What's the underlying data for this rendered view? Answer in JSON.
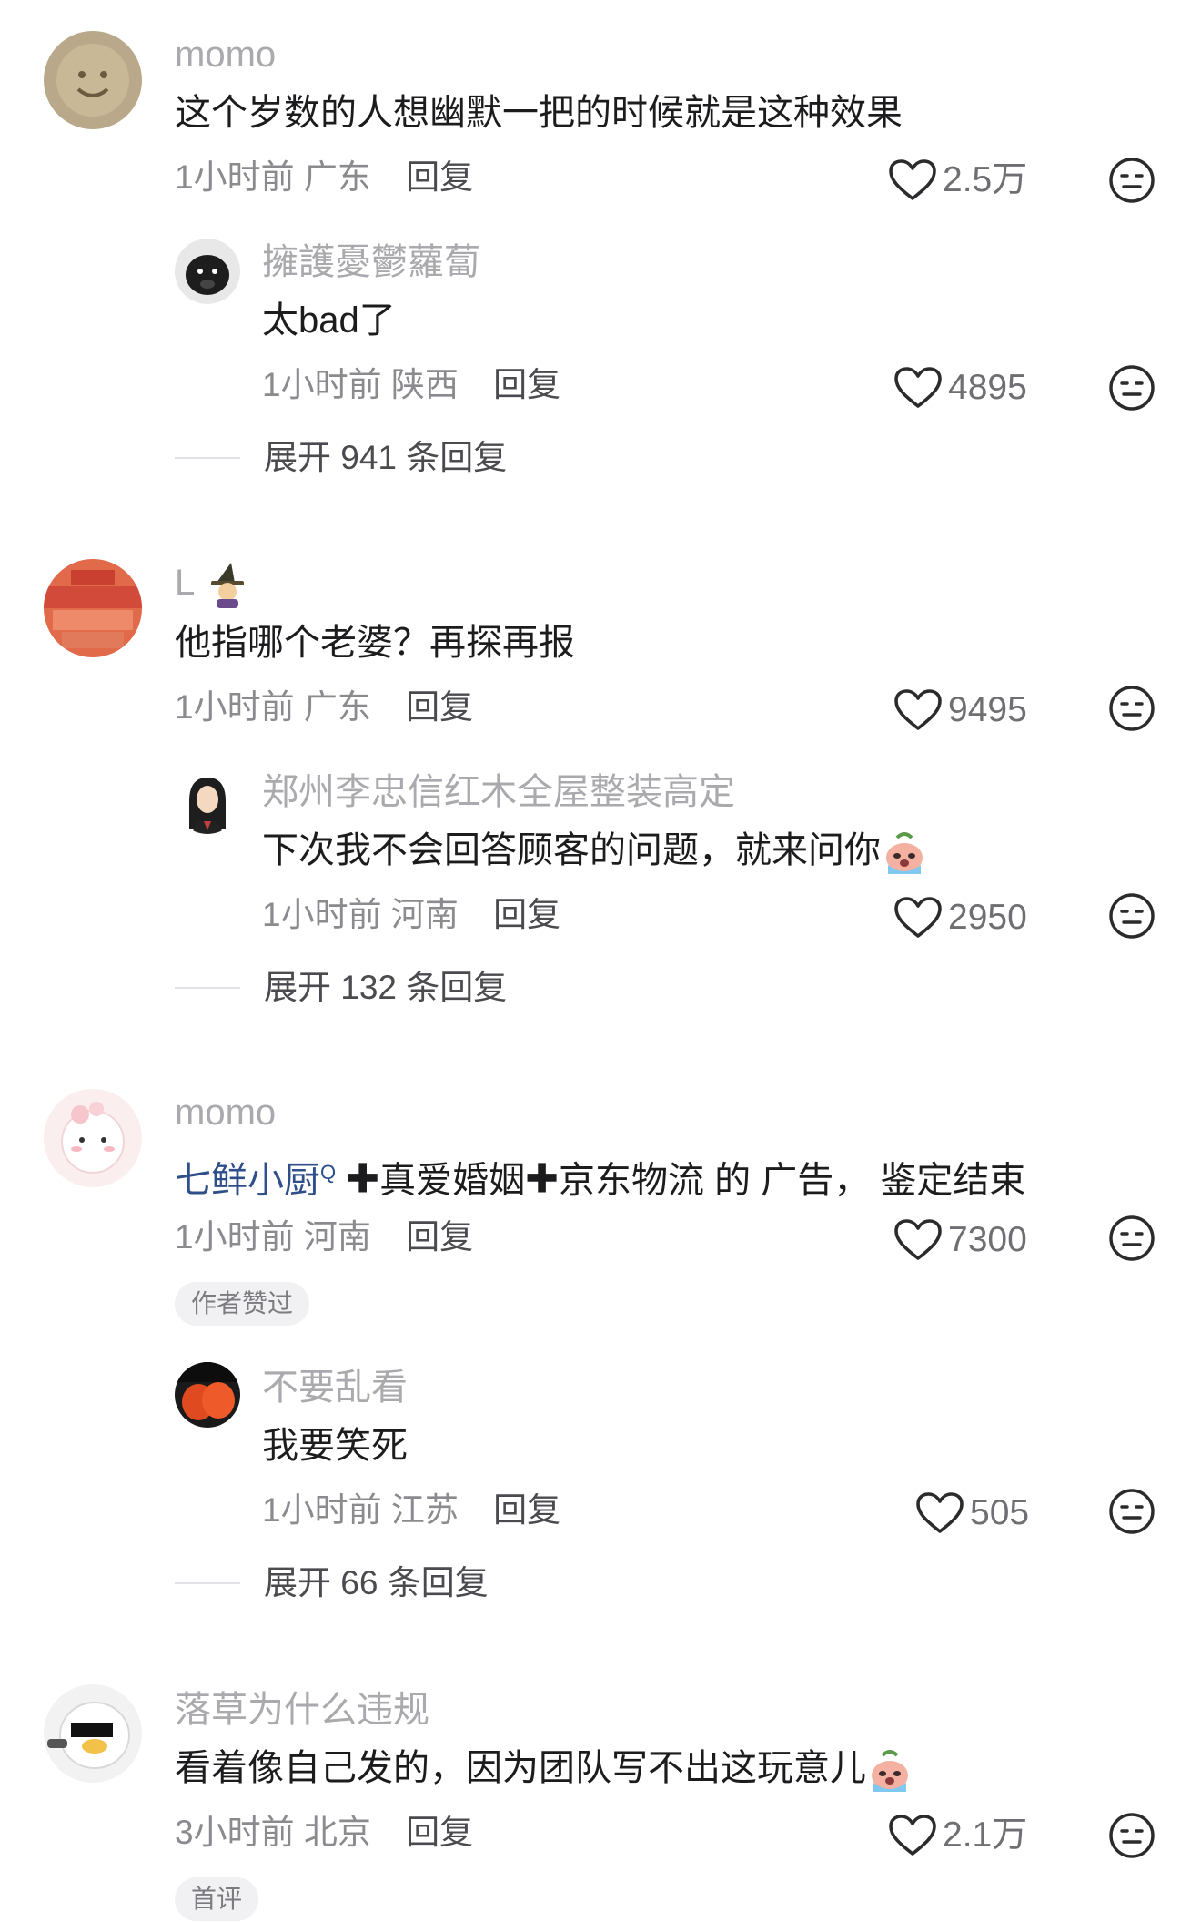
{
  "comments": [
    {
      "name": "momo",
      "text": "这个岁数的人想幽默一把的时候就是这种效果",
      "time": "1小时前",
      "location": "广东",
      "reply_label": "回复",
      "likes": "2.5万",
      "replies": [
        {
          "name": "擁護憂鬱蘿蔔",
          "text": "太bad了",
          "time": "1小时前",
          "location": "陕西",
          "reply_label": "回复",
          "likes": "4895"
        }
      ],
      "expand_label": "展开 941 条回复"
    },
    {
      "name": "L",
      "name_emoji": "witch-emoji",
      "text": "他指哪个老婆？再探再报",
      "time": "1小时前",
      "location": "广东",
      "reply_label": "回复",
      "likes": "9495",
      "replies": [
        {
          "name": "郑州李忠信红木全屋整装高定",
          "text": "下次我不会回答顾客的问题，就来问你",
          "text_emoji": "crying-face-emoji",
          "time": "1小时前",
          "location": "河南",
          "reply_label": "回复",
          "likes": "2950"
        }
      ],
      "expand_label": "展开 132 条回复"
    },
    {
      "name": "momo",
      "text_parts": {
        "link": "七鲜小厨",
        "sup": "Q",
        "plus": "✚",
        "part2": "真爱婚姻",
        "part3": "京东物流 的 广告，  鉴定结束"
      },
      "time": "1小时前",
      "location": "河南",
      "reply_label": "回复",
      "likes": "7300",
      "badge": "作者赞过",
      "replies": [
        {
          "name": "不要乱看",
          "text": "我要笑死",
          "time": "1小时前",
          "location": "江苏",
          "reply_label": "回复",
          "likes": "505"
        }
      ],
      "expand_label": "展开 66 条回复"
    },
    {
      "name": "落草为什么违规",
      "text": "看着像自己发的，因为团队写不出这玩意儿",
      "text_emoji": "crying-face-emoji",
      "time": "3小时前",
      "location": "北京",
      "reply_label": "回复",
      "likes": "2.1万",
      "badge": "首评"
    }
  ],
  "colors": {
    "name": "#a9a9ae",
    "text": "#1c1c1e",
    "meta": "#8a8a8f",
    "link": "#2f4f8a",
    "badge_bg": "#f1f1f3"
  },
  "icons": {
    "like": "heart-outline-icon",
    "dislike": "meh-face-icon"
  }
}
